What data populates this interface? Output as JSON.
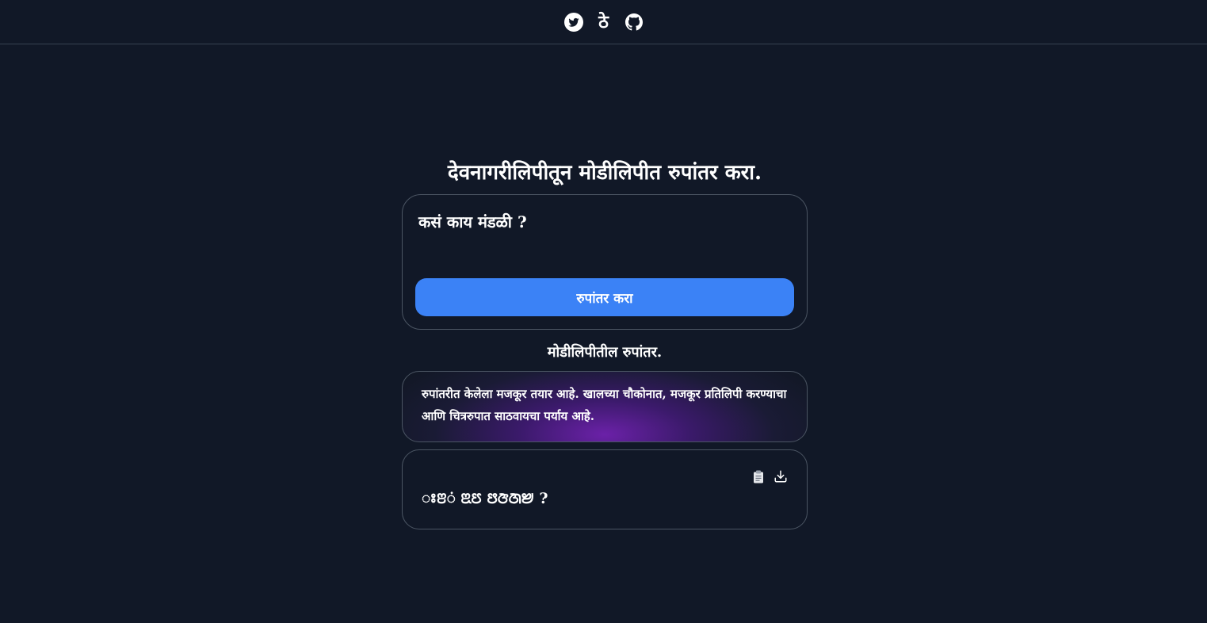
{
  "header": {
    "icons": [
      "twitter-icon",
      "logo-icon",
      "github-icon"
    ],
    "logo_glyph": "ठे"
  },
  "main": {
    "title": "देवनागरीलिपीतून मोडीलिपीत रुपांतर करा.",
    "input_value": "कसं काय मंडळी ?",
    "convert_button": "रुपांतर करा",
    "output_heading": "मोडीलिपीतील रुपांतर.",
    "notice_text": "रुपांतरीत केलेला मजकूर तयार आहे. खालच्या चौकोनात, मजकूर प्रतिलिपी करण्याचा आणि चित्ररुपात साठवायचा पर्याय आहे.",
    "output_text": "ꢁꢂं ꢃꢄ ꢅꢆꢇꢈ ?"
  },
  "colors": {
    "background": "#111827",
    "accent": "#3b82f6",
    "border": "#4b5563"
  }
}
